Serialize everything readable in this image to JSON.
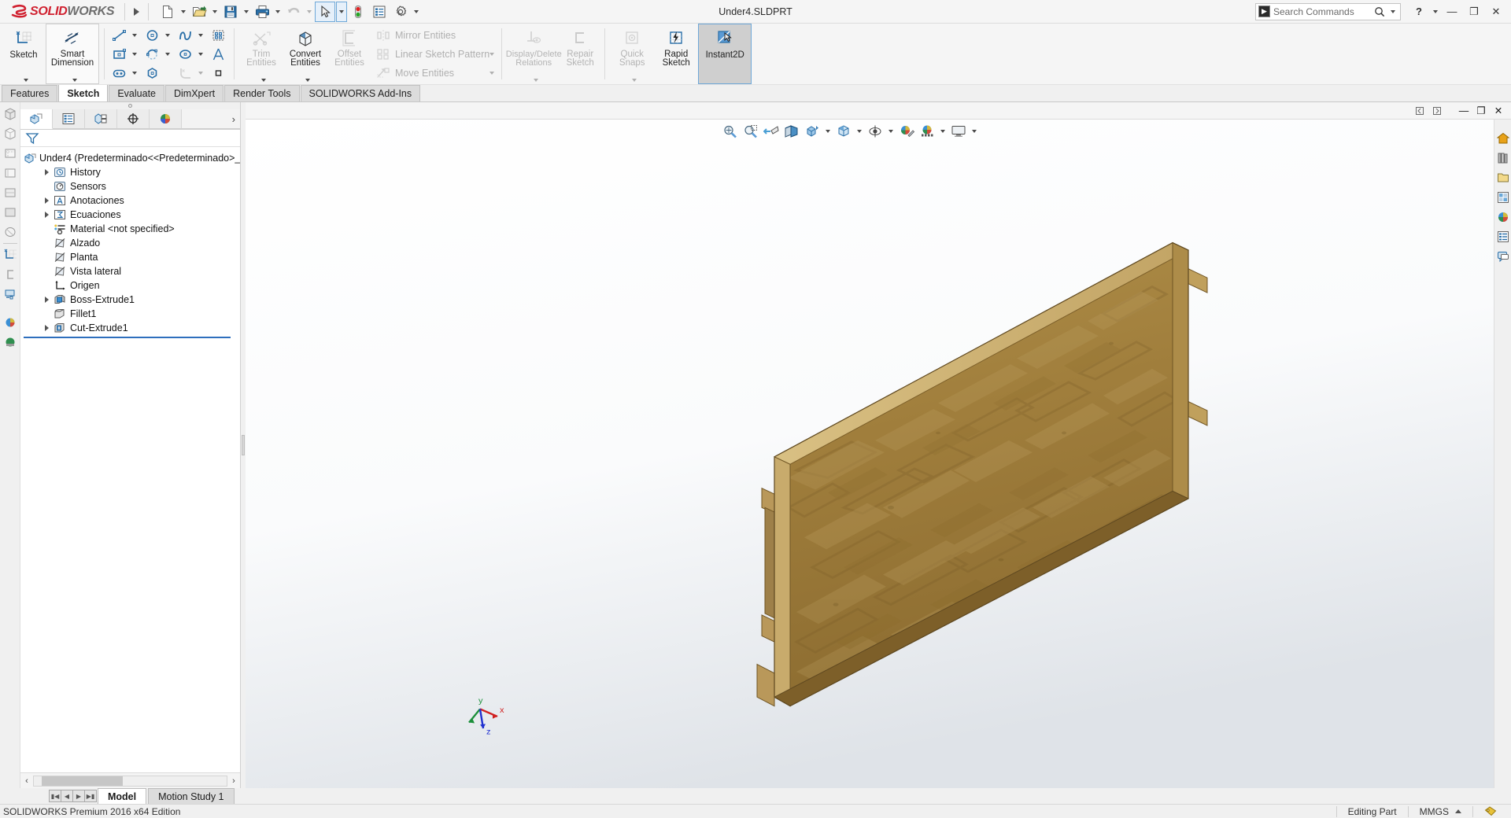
{
  "titlebar": {
    "brand_ds": "2S",
    "brand_solid": "SOLID",
    "brand_works": "WORKS",
    "document_title": "Under4.SLDPRT",
    "buttons": [
      {
        "name": "new-document",
        "label": "New"
      },
      {
        "name": "open-document",
        "label": "Open"
      },
      {
        "name": "save-document",
        "label": "Save"
      },
      {
        "name": "print-document",
        "label": "Print"
      },
      {
        "name": "undo",
        "label": "Undo"
      },
      {
        "name": "select",
        "label": "Select"
      },
      {
        "name": "rebuild",
        "label": "Rebuild"
      },
      {
        "name": "file-properties",
        "label": "File Properties"
      },
      {
        "name": "options",
        "label": "Options"
      }
    ],
    "search_placeholder": "Search Commands",
    "help_label": "?",
    "minimize_label": "—",
    "restore_label": "❐",
    "close_label": "✕"
  },
  "ribbon": {
    "groups": [
      {
        "name": "sketch-group",
        "big_buttons": [
          {
            "name": "sketch",
            "label": "Sketch",
            "state": "normal",
            "dropdown": true
          },
          {
            "name": "smart-dimension",
            "label": "Smart\nDimension",
            "line1": "Smart",
            "line2": "Dimension",
            "state": "framed",
            "dropdown": true
          }
        ]
      },
      {
        "name": "entities-grid",
        "cells": [
          {
            "name": "line-tool",
            "dropdown": true
          },
          {
            "name": "rectangle-tool",
            "dropdown": true
          },
          {
            "name": "slot-tool",
            "dropdown": true
          },
          {
            "name": "circle-tool",
            "dropdown": true
          },
          {
            "name": "arc-tool",
            "dropdown": true
          },
          {
            "name": "polygon-tool",
            "dropdown": false
          },
          {
            "name": "spline-tool",
            "dropdown": true
          },
          {
            "name": "ellipse-tool",
            "dropdown": true
          },
          {
            "name": "fillet-tool",
            "dropdown": true,
            "disabled": true
          },
          {
            "name": "sketch-pattern-tool",
            "dropdown": false
          },
          {
            "name": "text-tool",
            "dropdown": false
          },
          {
            "name": "point-tool",
            "dropdown": false
          }
        ]
      },
      {
        "name": "modify-group",
        "big_buttons": [
          {
            "name": "trim-entities",
            "line1": "Trim",
            "line2": "Entities",
            "state": "disabled",
            "dropdown": true
          },
          {
            "name": "convert-entities",
            "line1": "Convert",
            "line2": "Entities",
            "state": "normal",
            "dropdown": true
          },
          {
            "name": "offset-entities",
            "line1": "Offset",
            "line2": "Entities",
            "state": "disabled",
            "dropdown": false
          }
        ]
      },
      {
        "name": "pattern-group",
        "text_rows": [
          {
            "name": "mirror-entities",
            "label": "Mirror Entities",
            "dropdown": false,
            "disabled": true
          },
          {
            "name": "linear-sketch-pattern",
            "label": "Linear Sketch Pattern",
            "dropdown": true,
            "disabled": true
          },
          {
            "name": "move-entities",
            "label": "Move Entities",
            "dropdown": true,
            "disabled": true
          }
        ]
      },
      {
        "name": "relations-group",
        "big_buttons": [
          {
            "name": "display-delete-relations",
            "line1": "Display/Delete",
            "line2": "Relations",
            "state": "disabled",
            "dropdown": true
          },
          {
            "name": "repair-sketch",
            "line1": "Repair",
            "line2": "Sketch",
            "state": "disabled",
            "dropdown": false
          }
        ]
      },
      {
        "name": "snaps-group",
        "big_buttons": [
          {
            "name": "quick-snaps",
            "line1": "Quick",
            "line2": "Snaps",
            "state": "disabled",
            "dropdown": true
          },
          {
            "name": "rapid-sketch",
            "line1": "Rapid",
            "line2": "Sketch",
            "state": "normal",
            "dropdown": false
          },
          {
            "name": "instant-2d",
            "line1": "Instant2D",
            "line2": "",
            "state": "active",
            "dropdown": false
          }
        ]
      }
    ]
  },
  "command_tabs": [
    {
      "name": "tab-features",
      "label": "Features",
      "active": false
    },
    {
      "name": "tab-sketch",
      "label": "Sketch",
      "active": true
    },
    {
      "name": "tab-evaluate",
      "label": "Evaluate",
      "active": false
    },
    {
      "name": "tab-dimxpert",
      "label": "DimXpert",
      "active": false
    },
    {
      "name": "tab-render-tools",
      "label": "Render Tools",
      "active": false
    },
    {
      "name": "tab-solidworks-addins",
      "label": "SOLIDWORKS Add-Ins",
      "active": false
    }
  ],
  "tree_panel": {
    "tabs": [
      {
        "name": "tree-tab-feature-manager",
        "label": "FeatureManager",
        "active": true
      },
      {
        "name": "tree-tab-property-manager",
        "label": "PropertyManager",
        "active": false
      },
      {
        "name": "tree-tab-configuration-manager",
        "label": "ConfigurationManager",
        "active": false
      },
      {
        "name": "tree-tab-dimxpert-manager",
        "label": "DimXpertManager",
        "active": false
      },
      {
        "name": "tree-tab-display-manager",
        "label": "DisplayManager",
        "active": false
      }
    ],
    "filter_label": "filter-icon",
    "items": [
      {
        "name": "tree-item-root",
        "label": "Under4  (Predeterminado<<Predeterminado>_",
        "icon": "part-icon",
        "expandable": false,
        "indent": 0
      },
      {
        "name": "tree-item-history",
        "label": "History",
        "icon": "history-icon",
        "expandable": true,
        "indent": 1
      },
      {
        "name": "tree-item-sensors",
        "label": "Sensors",
        "icon": "sensors-icon",
        "expandable": false,
        "indent": 1
      },
      {
        "name": "tree-item-anotaciones",
        "label": "Anotaciones",
        "icon": "annotations-icon",
        "expandable": true,
        "indent": 1
      },
      {
        "name": "tree-item-ecuaciones",
        "label": "Ecuaciones",
        "icon": "equations-icon",
        "expandable": true,
        "indent": 1
      },
      {
        "name": "tree-item-material",
        "label": "Material <not specified>",
        "icon": "material-icon",
        "expandable": false,
        "indent": 1
      },
      {
        "name": "tree-item-alzado",
        "label": "Alzado",
        "icon": "plane-icon",
        "expandable": false,
        "indent": 1
      },
      {
        "name": "tree-item-planta",
        "label": "Planta",
        "icon": "plane-icon",
        "expandable": false,
        "indent": 1
      },
      {
        "name": "tree-item-vista-lateral",
        "label": "Vista lateral",
        "icon": "plane-icon",
        "expandable": false,
        "indent": 1
      },
      {
        "name": "tree-item-origen",
        "label": "Origen",
        "icon": "origin-icon",
        "expandable": false,
        "indent": 1
      },
      {
        "name": "tree-item-boss-extrude1",
        "label": "Boss-Extrude1",
        "icon": "boss-extrude-icon",
        "expandable": true,
        "indent": 1
      },
      {
        "name": "tree-item-fillet1",
        "label": "Fillet1",
        "icon": "fillet-icon",
        "expandable": false,
        "indent": 1
      },
      {
        "name": "tree-item-cut-extrude1",
        "label": "Cut-Extrude1",
        "icon": "cut-extrude-icon",
        "expandable": true,
        "indent": 1
      }
    ]
  },
  "viewport": {
    "window_buttons": [
      {
        "name": "viewport-prev-window",
        "label": "◁"
      },
      {
        "name": "viewport-next-window",
        "label": "▷"
      },
      {
        "name": "viewport-restore",
        "label": "❐"
      },
      {
        "name": "viewport-minimize",
        "label": "—"
      },
      {
        "name": "viewport-close",
        "label": "✕"
      }
    ],
    "hud_buttons": [
      {
        "name": "zoom-to-fit-icon",
        "dropdown": false
      },
      {
        "name": "zoom-to-area-icon",
        "dropdown": false
      },
      {
        "name": "previous-view-icon",
        "dropdown": false
      },
      {
        "name": "section-view-icon",
        "dropdown": false
      },
      {
        "name": "view-orientation-icon",
        "dropdown": true
      },
      {
        "name": "display-style-icon",
        "dropdown": true
      },
      {
        "name": "hide-show-items-icon",
        "dropdown": true
      },
      {
        "name": "edit-appearance-icon",
        "dropdown": false
      },
      {
        "name": "apply-scene-icon",
        "dropdown": true
      },
      {
        "name": "view-settings-icon",
        "dropdown": true
      }
    ],
    "triad_labels": {
      "x": "x",
      "y": "y",
      "z": "z"
    },
    "model_colors": {
      "osb_base": "#a8833f",
      "osb_dark": "#7d5f2a",
      "osb_light": "#c9a964",
      "edge": "#5a4420",
      "background_top": "#ffffff",
      "background_bottom": "#e2e5e9"
    }
  },
  "bottom": {
    "nav_buttons": [
      {
        "name": "first-sheet-button",
        "label": "⏮"
      },
      {
        "name": "prev-sheet-button",
        "label": "◀"
      },
      {
        "name": "next-sheet-button",
        "label": "▶"
      },
      {
        "name": "last-sheet-button",
        "label": "⏭"
      }
    ],
    "tabs": [
      {
        "name": "bottom-tab-model",
        "label": "Model",
        "active": true
      },
      {
        "name": "bottom-tab-motion-study",
        "label": "Motion Study 1",
        "active": false
      }
    ]
  },
  "statusbar": {
    "edition": "SOLIDWORKS Premium 2016 x64 Edition",
    "mode": "Editing Part",
    "units": "MMGS"
  }
}
